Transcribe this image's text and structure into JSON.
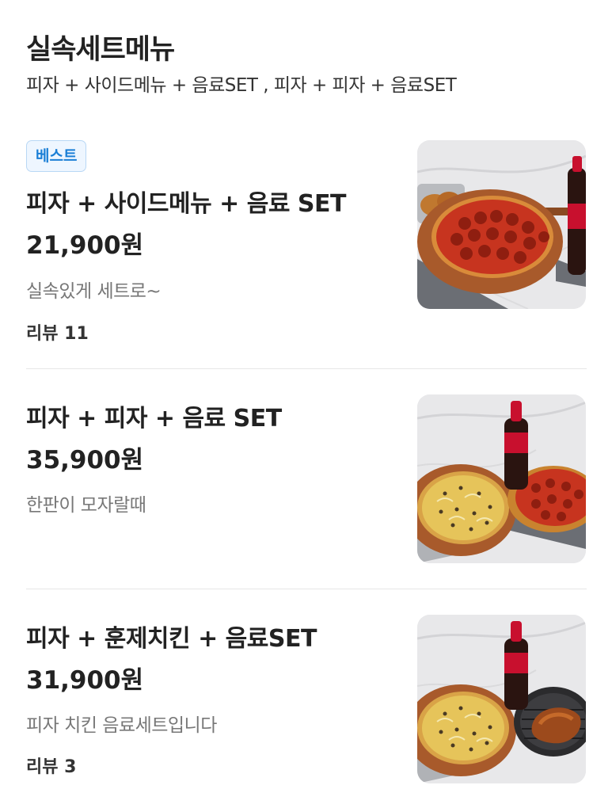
{
  "header": {
    "title": "실속세트메뉴",
    "subtitle": "피자 + 사이드메뉴 + 음료SET , 피자 + 피자 + 음료SET"
  },
  "menu_items": [
    {
      "badge": "베스트",
      "name": "피자 + 사이드메뉴 + 음료 SET",
      "price": "21,900원",
      "description": "실속있게 세트로~",
      "reviews": "리뷰 11",
      "image": "pepperoni-pizza-with-side-and-cola"
    },
    {
      "name": "피자 + 피자 + 음료 SET",
      "price": "35,900원",
      "description": "한판이 모자랄때",
      "image": "two-pizzas-with-cola"
    },
    {
      "name": "피자 + 훈제치킨 + 음료SET",
      "price": "31,900원",
      "description": "피자 치킨 음료세트입니다",
      "reviews": "리뷰 3",
      "image": "pizza-smoked-chicken-and-cola"
    }
  ],
  "colors": {
    "badge_text": "#1b7fd6",
    "badge_background": "#eef6ff",
    "description_text": "#777777",
    "divider": "#e6e6e6"
  }
}
